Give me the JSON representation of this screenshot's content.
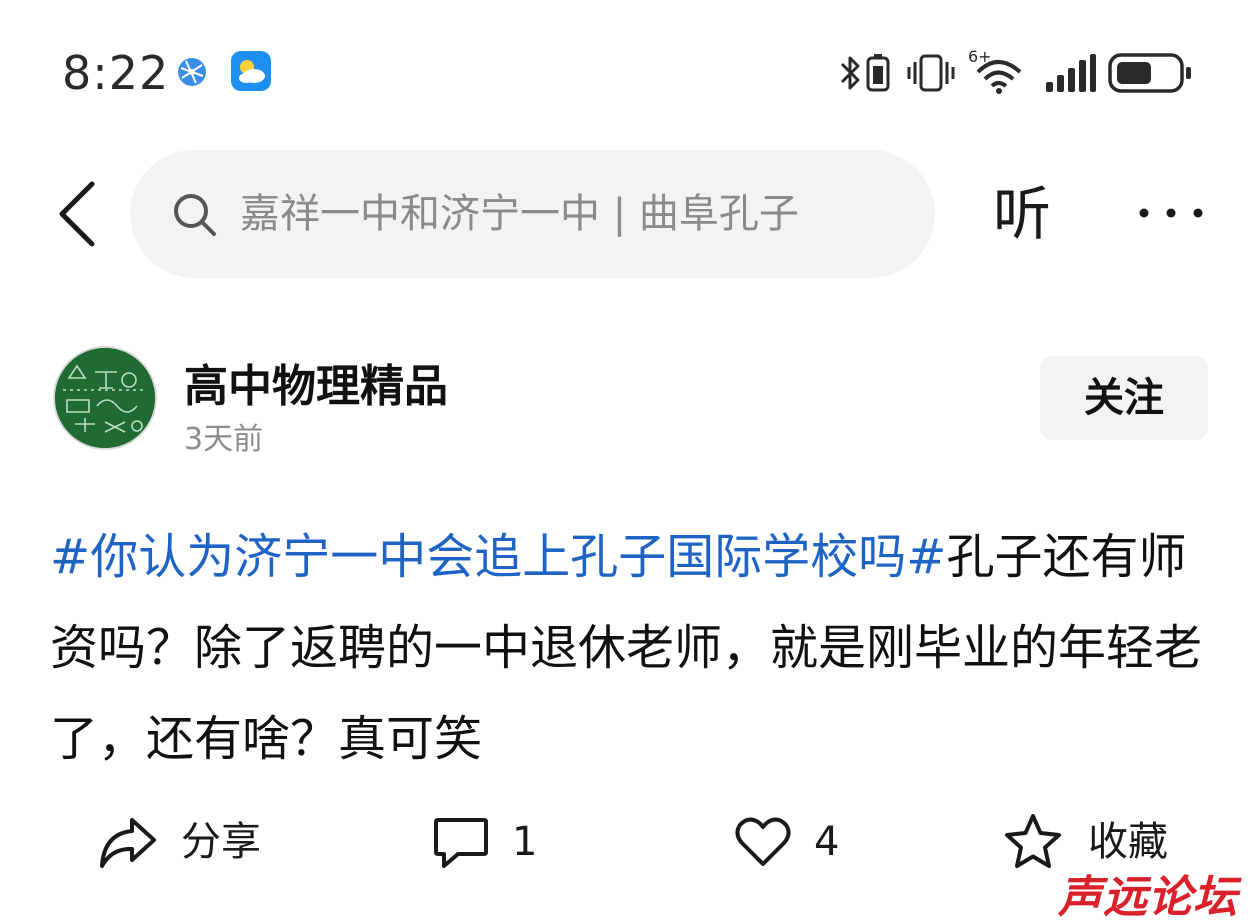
{
  "status_bar": {
    "time": "8:22",
    "signal_label": "6+",
    "icons": [
      "network-globe-icon",
      "weather-app-icon",
      "bluetooth-icon",
      "vibrate-icon",
      "wifi-icon",
      "cell-signal-icon",
      "battery-icon"
    ]
  },
  "top_bar": {
    "back_icon": "chevron-left-icon",
    "search_icon": "search-icon",
    "search_text": "嘉祥一中和济宁一中 | 曲阜孔子",
    "listen_label": "听",
    "more_icon": "ellipsis-icon"
  },
  "author": {
    "name": "高中物理精品",
    "time": "3天前",
    "follow_label": "关注"
  },
  "post": {
    "hashtag": "#你认为济宁一中会追上孔子国际学校吗#",
    "text": "孔子还有师资吗？除了返聘的一中退休老师，就是刚毕业的年轻老了，还有啥？真可笑"
  },
  "actions": {
    "share_label": "分享",
    "comment_count": "1",
    "like_count": "4",
    "favorite_label": "收藏"
  },
  "watermark": "声远论坛",
  "colors": {
    "hashtag": "#1f64c4",
    "search_bg": "#f2f3f5",
    "button_bg": "#f2f3f5",
    "watermark": "#d9202b",
    "avatar_bg": "#1f6b33"
  }
}
